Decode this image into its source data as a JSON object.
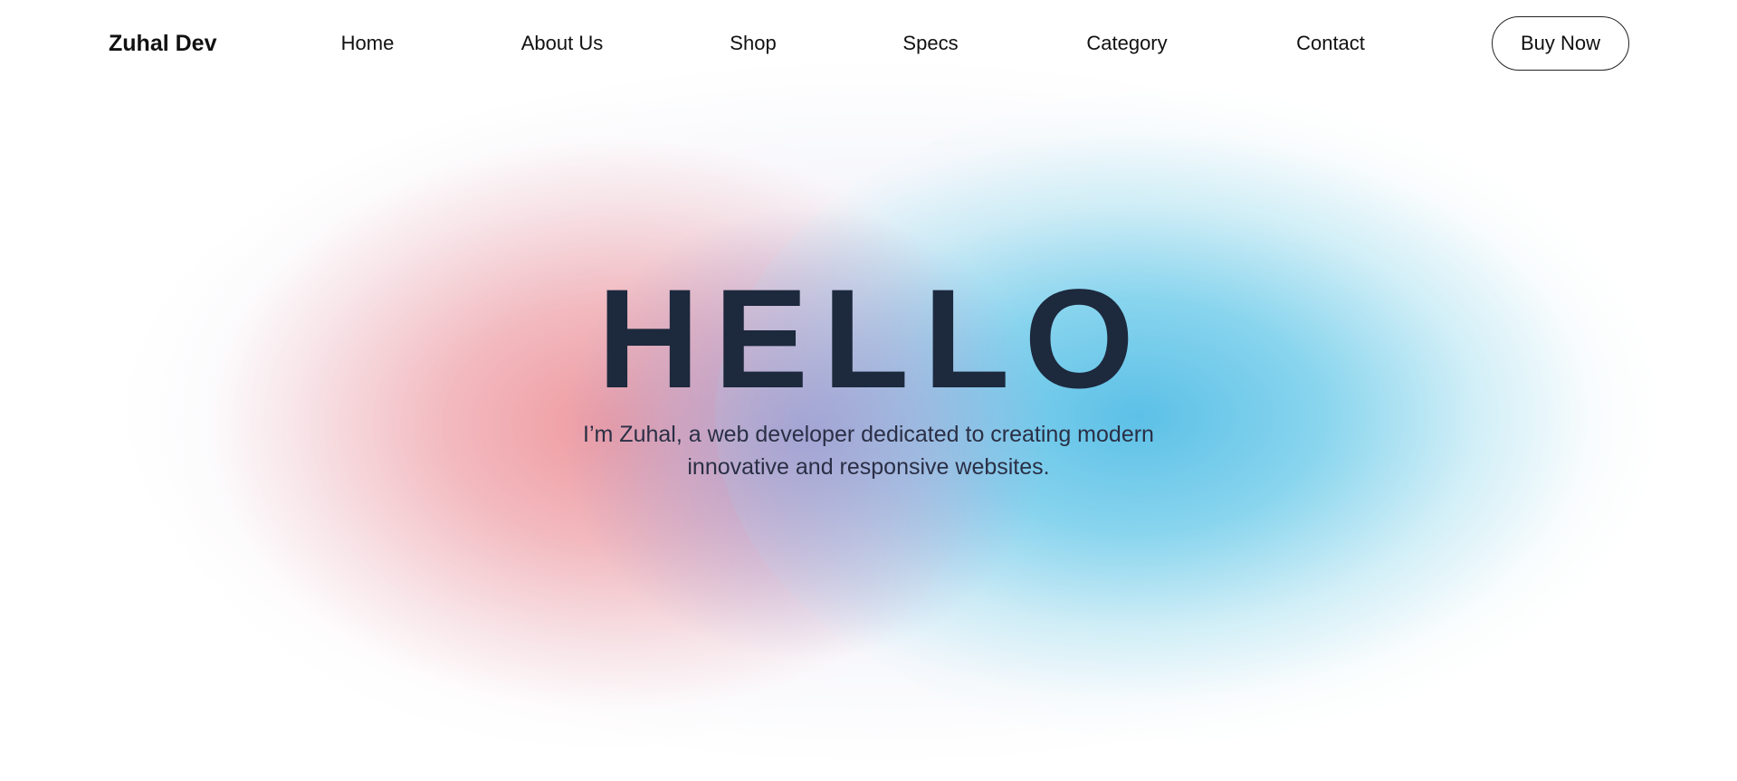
{
  "brand": {
    "name": "Zuhal Dev"
  },
  "nav": {
    "items": [
      {
        "label": "Home"
      },
      {
        "label": "About Us"
      },
      {
        "label": "Shop"
      },
      {
        "label": "Specs"
      },
      {
        "label": "Category"
      },
      {
        "label": "Contact"
      }
    ],
    "cta_label": "Buy Now"
  },
  "hero": {
    "title": "HELLO",
    "subtitle_line1": "I’m Zuhal, a web developer dedicated to creating modern",
    "subtitle_line2": "innovative and responsive websites."
  },
  "colors": {
    "title": "#1d293d",
    "text": "#111111",
    "glow_red": "#f0969b",
    "glow_blue": "#55bee6",
    "glow_purple": "#9696d2"
  }
}
